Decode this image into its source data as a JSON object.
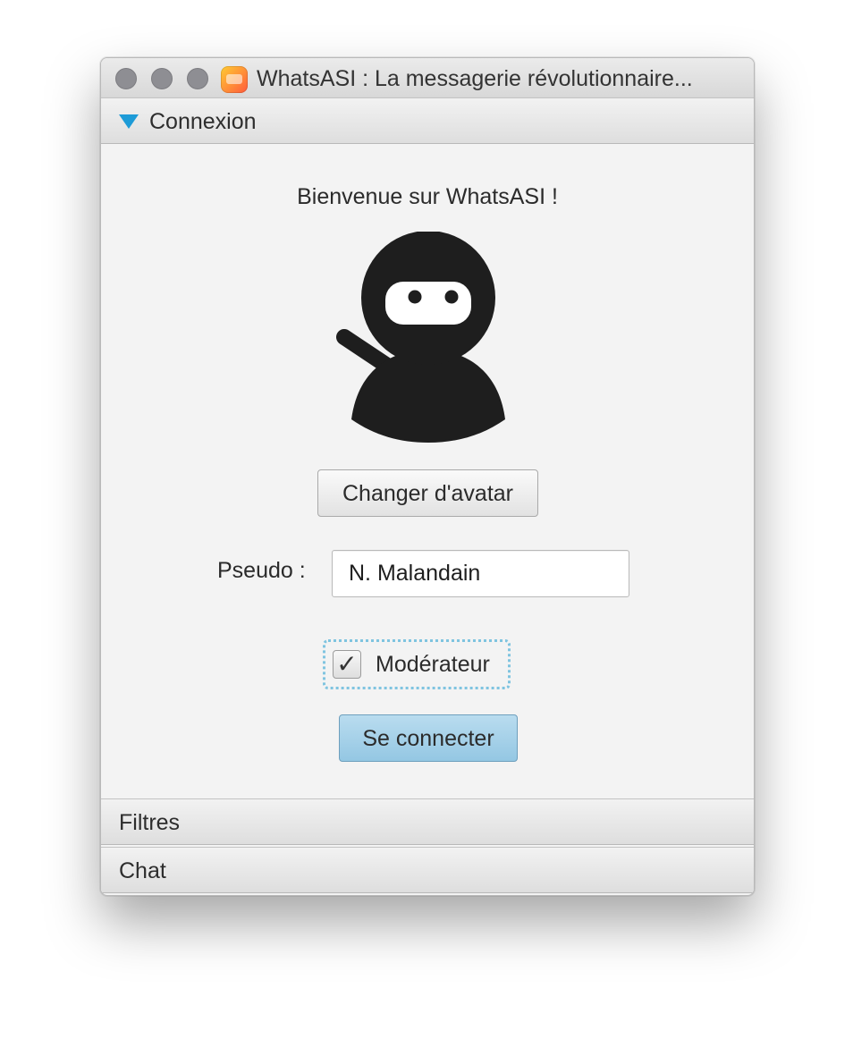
{
  "window": {
    "title": "WhatsASI : La messagerie révolutionnaire..."
  },
  "panes": {
    "connexion": {
      "label": "Connexion",
      "expanded": true
    },
    "filtres": {
      "label": "Filtres",
      "expanded": false
    },
    "chat": {
      "label": "Chat",
      "expanded": false
    }
  },
  "login": {
    "welcome": "Bienvenue sur WhatsASI !",
    "avatar_icon": "ninja-avatar",
    "change_avatar_label": "Changer d'avatar",
    "pseudo_label": "Pseudo :",
    "pseudo_value": "N. Malandain",
    "moderator_label": "Modérateur",
    "moderator_checked": true,
    "check_glyph": "✓",
    "connect_label": "Se connecter"
  },
  "colors": {
    "accent": "#1d9bd7",
    "primary_button": "#a6d2ea",
    "focus_ring": "#7fc4e0"
  }
}
